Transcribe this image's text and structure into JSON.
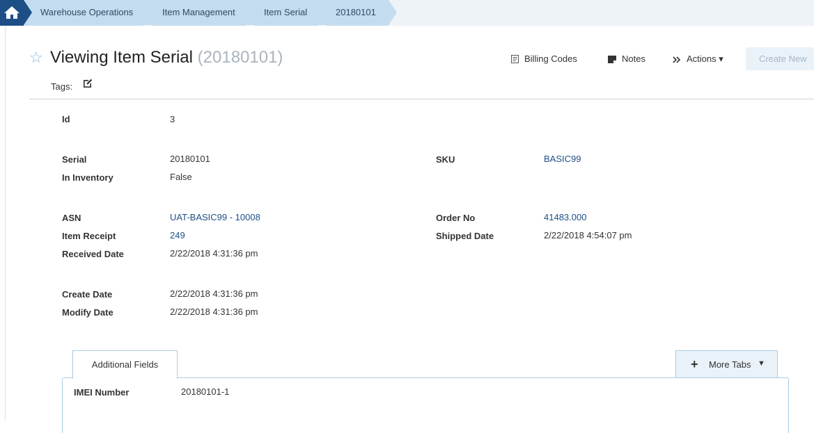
{
  "breadcrumb": {
    "items": [
      {
        "label": "Warehouse Operations"
      },
      {
        "label": "Item Management"
      },
      {
        "label": "Item Serial"
      },
      {
        "label": "20180101"
      }
    ]
  },
  "header": {
    "title": "Viewing Item Serial",
    "title_sub": "(20180101)",
    "tags_label": "Tags:"
  },
  "toolbar": {
    "billing_codes": "Billing Codes",
    "notes": "Notes",
    "actions": "Actions ▾",
    "create_new": "Create New"
  },
  "fields": {
    "id": {
      "label": "Id",
      "value": "3"
    },
    "serial": {
      "label": "Serial",
      "value": "20180101"
    },
    "in_inventory": {
      "label": "In Inventory",
      "value": "False"
    },
    "sku": {
      "label": "SKU",
      "value": "BASIC99"
    },
    "asn": {
      "label": "ASN",
      "value": "UAT-BASIC99 - 10008"
    },
    "item_receipt": {
      "label": "Item Receipt",
      "value": "249"
    },
    "received_date": {
      "label": "Received Date",
      "value": "2/22/2018  4:31:36 pm"
    },
    "order_no": {
      "label": "Order No",
      "value": "41483.000"
    },
    "shipped_date": {
      "label": "Shipped Date",
      "value": "2/22/2018  4:54:07 pm"
    },
    "create_date": {
      "label": "Create Date",
      "value": "2/22/2018  4:31:36 pm"
    },
    "modify_date": {
      "label": "Modify Date",
      "value": "2/22/2018  4:31:36 pm"
    }
  },
  "tabs": {
    "active": "Additional Fields",
    "more": "More Tabs",
    "more_caret": "▼"
  },
  "additional_fields": [
    {
      "label": "IMEI Number",
      "value": "20180101-1"
    }
  ]
}
